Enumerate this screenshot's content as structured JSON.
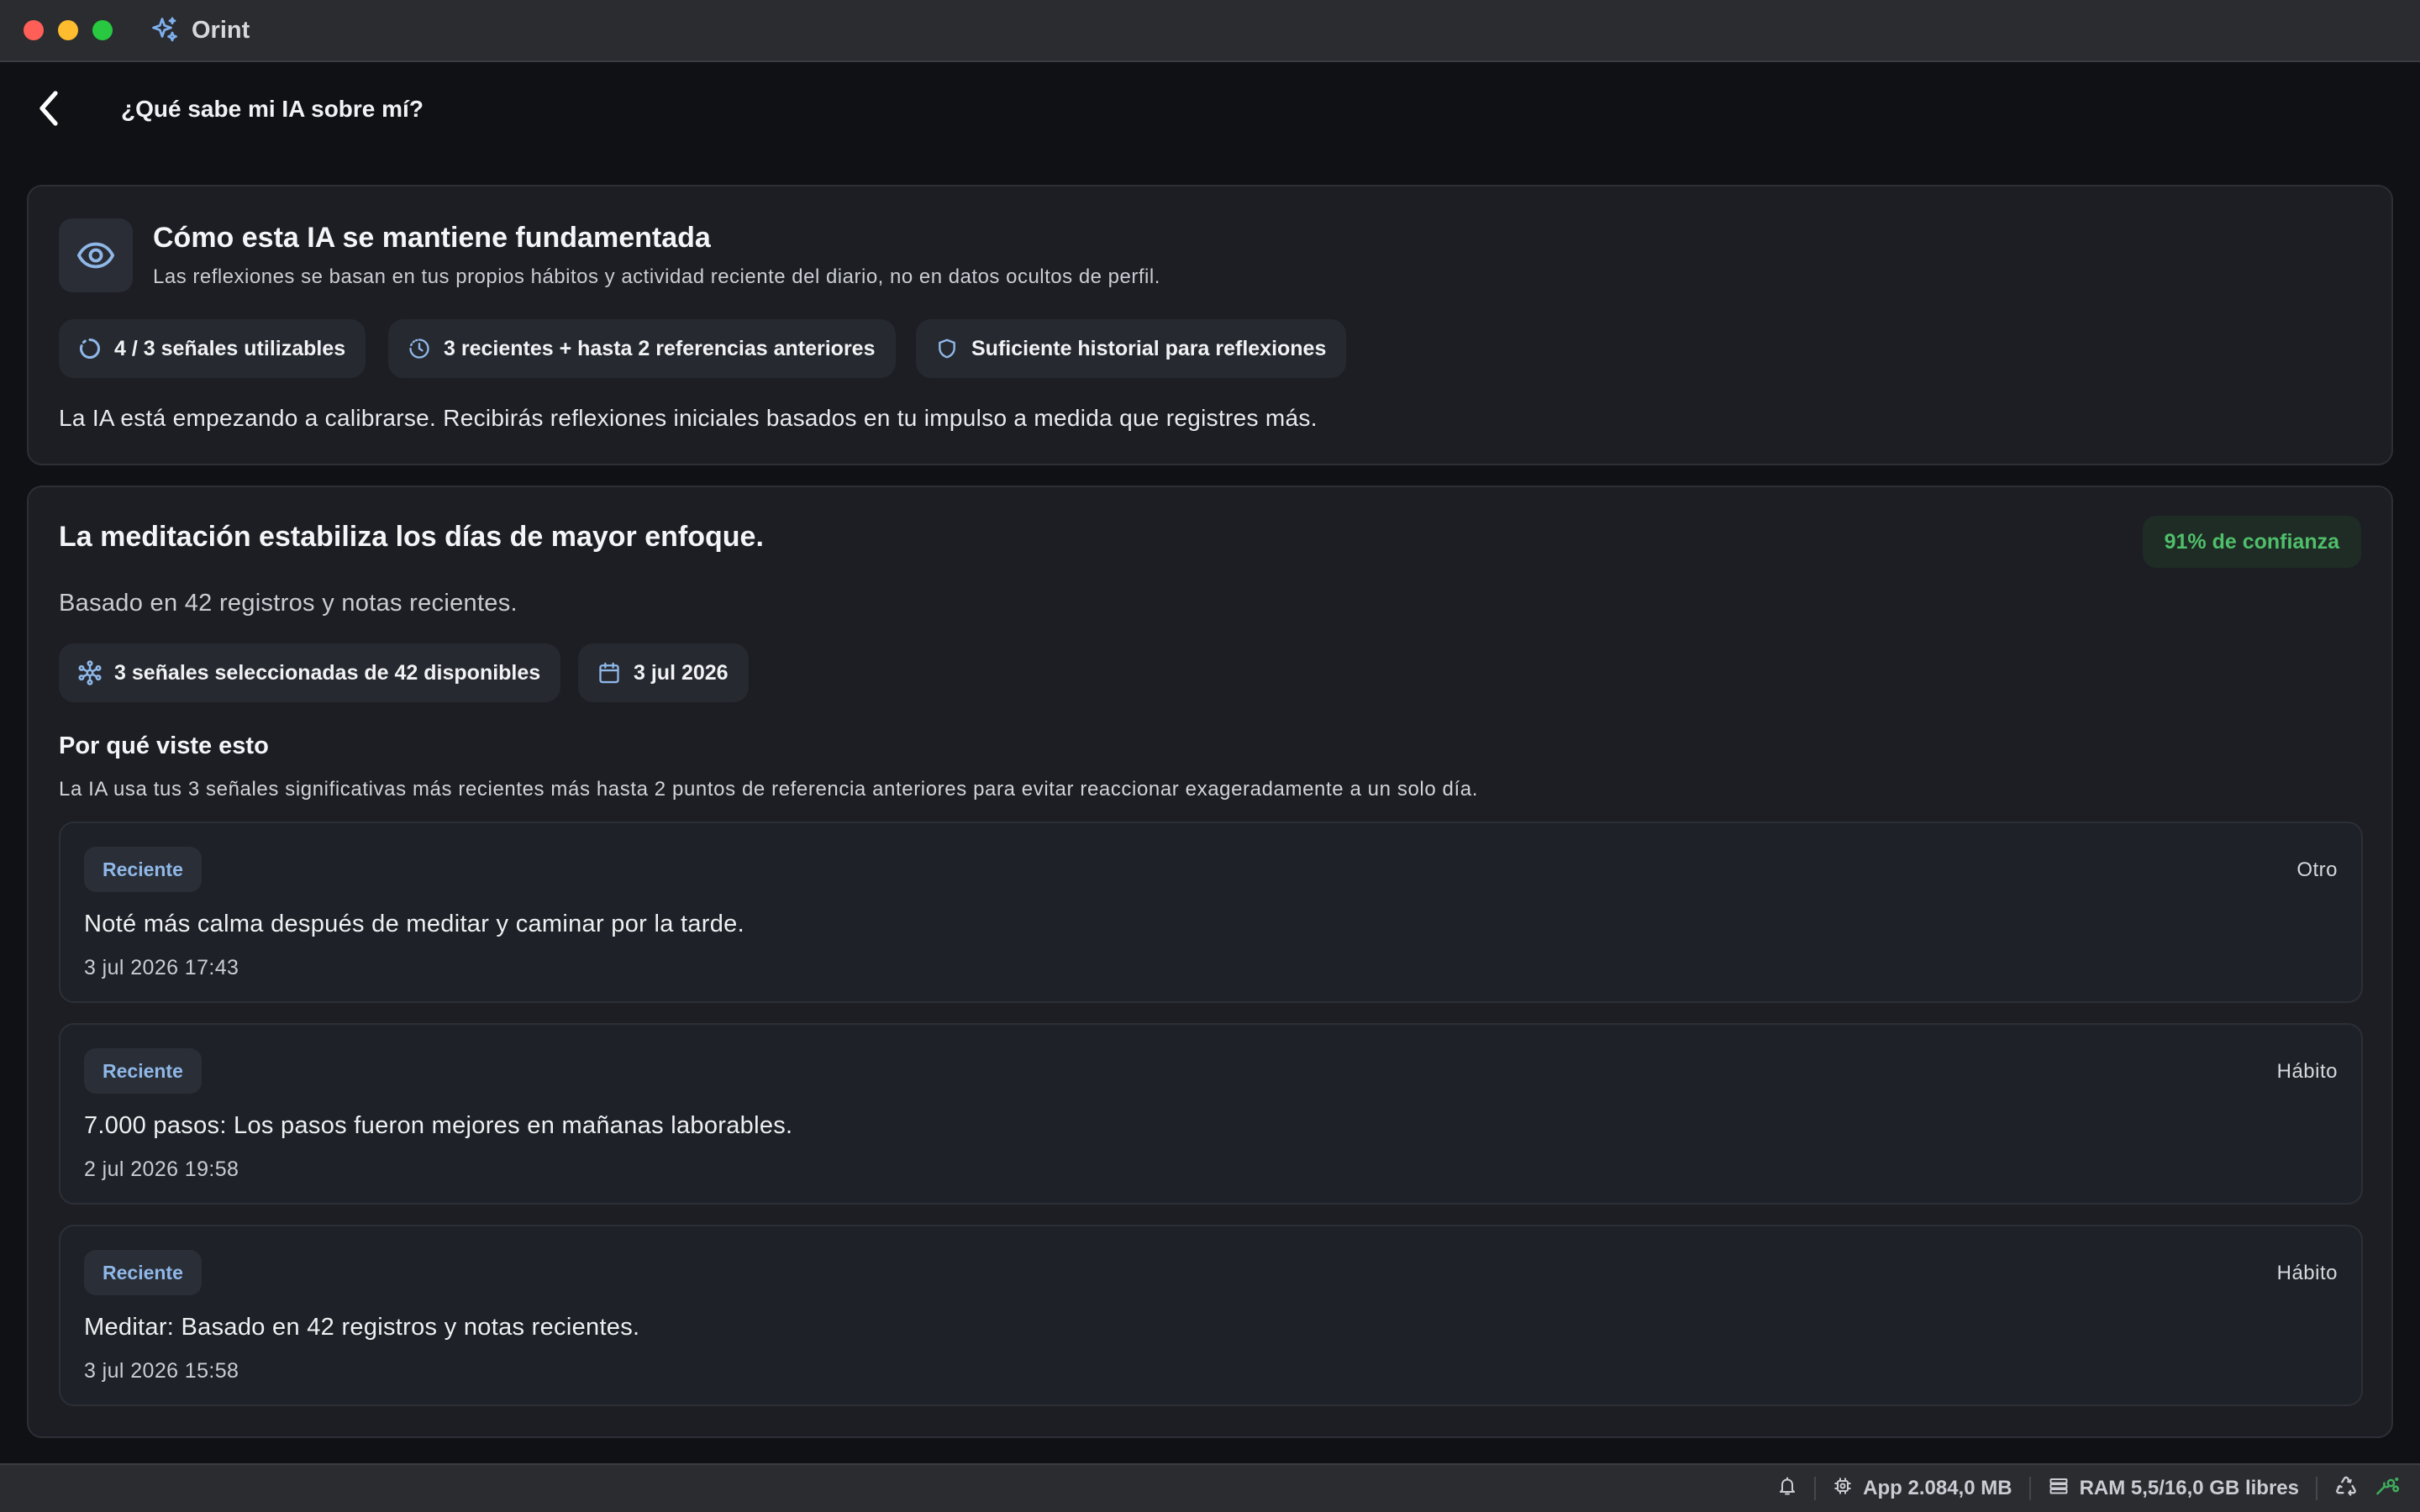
{
  "window": {
    "app_name": "Orint"
  },
  "header": {
    "title": "¿Qué sabe mi IA sobre mí?"
  },
  "grounding": {
    "title": "Cómo esta IA se mantiene fundamentada",
    "subtitle": "Las reflexiones se basan en tus propios hábitos y actividad reciente del diario, no en datos ocultos de perfil.",
    "chips": [
      {
        "icon": "progress-circle-icon",
        "label": "4 / 3 señales utilizables"
      },
      {
        "icon": "clock-icon",
        "label": "3 recientes + hasta 2 referencias anteriores"
      },
      {
        "icon": "shield-icon",
        "label": "Suficiente historial para reflexiones"
      }
    ],
    "message": "La IA está empezando a calibrarse. Recibirás reflexiones iniciales basados en tu impulso a medida que registres más."
  },
  "insight": {
    "title": "La meditación estabiliza los días de mayor enfoque.",
    "confidence": "91% de confianza",
    "based_on": "Basado en 42 registros y notas recientes.",
    "chips": [
      {
        "icon": "network-icon",
        "label": "3 señales seleccionadas de 42 disponibles"
      },
      {
        "icon": "calendar-icon",
        "label": "3 jul 2026"
      }
    ],
    "why_title": "Por qué viste esto",
    "why_desc": "La IA usa tus 3 señales significativas más recientes más hasta 2 puntos de referencia anteriores para evitar reaccionar exageradamente a un solo día.",
    "entries": [
      {
        "tag": "Reciente",
        "category": "Otro",
        "text": "Noté más calma después de meditar y caminar por la tarde.",
        "date": "3 jul 2026 17:43"
      },
      {
        "tag": "Reciente",
        "category": "Hábito",
        "text": "7.000 pasos: Los pasos fueron mejores en mañanas laborables.",
        "date": "2 jul 2026 19:58"
      },
      {
        "tag": "Reciente",
        "category": "Hábito",
        "text": "Meditar: Basado en 42 registros y notas recientes.",
        "date": "3 jul 2026 15:58"
      }
    ]
  },
  "statusbar": {
    "app_memory": "App 2.084,0 MB",
    "ram": "RAM 5,5/16,0 GB libres"
  },
  "colors": {
    "accent_blue": "#8fb8e8",
    "confidence_green": "#4fbf6a",
    "card_bg": "#1c1e24",
    "page_bg": "#0f1115"
  }
}
